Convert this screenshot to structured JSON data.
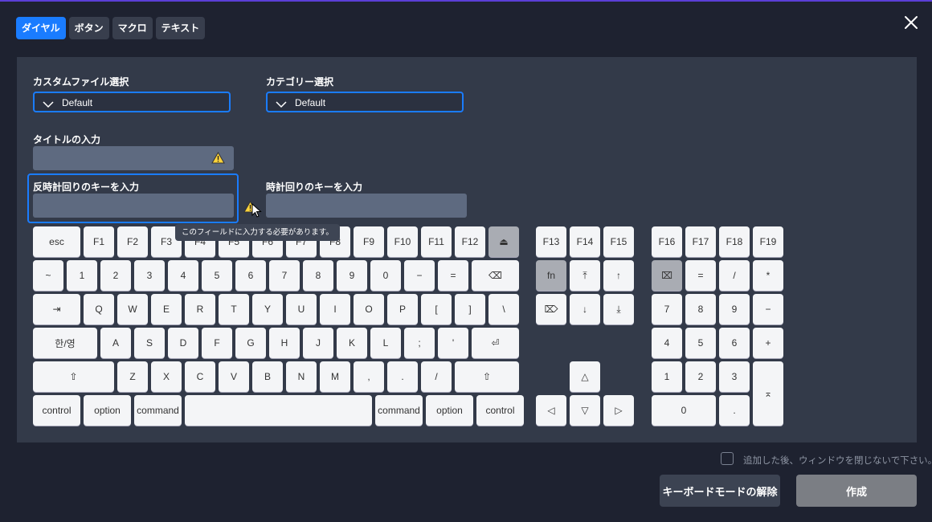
{
  "tabs": [
    "ダイヤル",
    "ボタン",
    "マクロ",
    "テキスト"
  ],
  "active_tab": 0,
  "icons": {
    "close": "close-icon",
    "warning": "warning-icon",
    "chevron": "chevron-down-icon",
    "cursor": "mouse-cursor-icon"
  },
  "colors": {
    "accent": "#1a7cff",
    "panel": "#333a49",
    "background": "#1e2230",
    "warning": "#ffd43b"
  },
  "form": {
    "custom_file": {
      "label": "カスタムファイル選択",
      "value": "Default"
    },
    "category": {
      "label": "カテゴリー選択",
      "value": "Default"
    },
    "title": {
      "label": "タイトルの入力",
      "value": ""
    },
    "ccw_key": {
      "label": "反時計回りのキーを入力",
      "value": ""
    },
    "cw_key": {
      "label": "時計回りのキーを入力",
      "value": ""
    },
    "tooltip": "このフィールドに入力する必要があります。"
  },
  "keyboard": {
    "main": [
      [
        "esc",
        "F1",
        "F2",
        "F3",
        "F4",
        "F5",
        "F6",
        "F7",
        "F8",
        "F9",
        "F10",
        "F11",
        "F12",
        "⏏"
      ],
      [
        "~",
        "1",
        "2",
        "3",
        "4",
        "5",
        "6",
        "7",
        "8",
        "9",
        "0",
        "−",
        "=",
        "⌫"
      ],
      [
        "⇥",
        "Q",
        "W",
        "E",
        "R",
        "T",
        "Y",
        "U",
        "I",
        "O",
        "P",
        "[",
        "]",
        "\\"
      ],
      [
        "한/영",
        "A",
        "S",
        "D",
        "F",
        "G",
        "H",
        "J",
        "K",
        "L",
        ";",
        "'",
        "⏎"
      ],
      [
        "⇧",
        "Z",
        "X",
        "C",
        "V",
        "B",
        "N",
        "M",
        ",",
        ".",
        "/",
        "⇧"
      ],
      [
        "control",
        "option",
        "command",
        "",
        "command",
        "option",
        "control"
      ]
    ],
    "nav": [
      [
        "F13",
        "F14",
        "F15"
      ],
      [
        "fn",
        "⤒",
        "↑"
      ],
      [
        "⌦",
        "↓",
        "⤓"
      ],
      [
        "△"
      ],
      [
        "◁",
        "▽",
        "▷"
      ]
    ],
    "numpad": [
      [
        "F16",
        "F17",
        "F18",
        "F19"
      ],
      [
        "⌧",
        "=",
        "/",
        "*"
      ],
      [
        "7",
        "8",
        "9",
        "−"
      ],
      [
        "4",
        "5",
        "6",
        "+"
      ],
      [
        "1",
        "2",
        "3",
        "⌅"
      ],
      [
        "0",
        "."
      ]
    ]
  },
  "footer": {
    "checkbox_label": "追加した後、ウィンドウを閉じないで下さい。",
    "checked": false,
    "release_button": "キーボードモードの解除",
    "create_button": "作成"
  }
}
